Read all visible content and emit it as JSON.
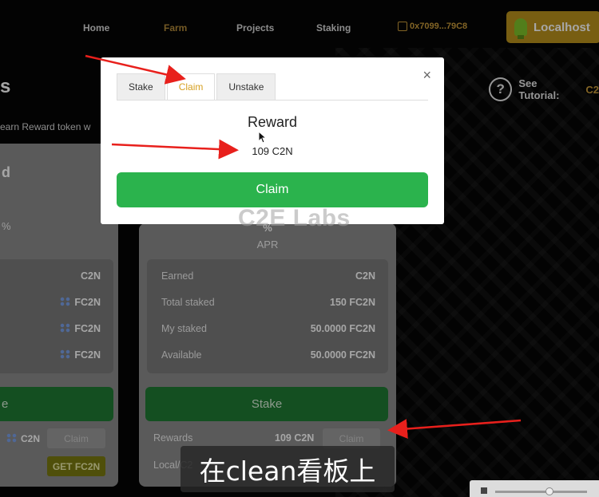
{
  "nav": {
    "links": [
      "Home",
      "Farm",
      "Projects",
      "Staking"
    ],
    "wallet_address": "0x7099...79C8",
    "network_button": "Localhost"
  },
  "page": {
    "title_fragment": "s",
    "subtitle_fragment": "earn Reward token w",
    "tutorial_label": "See Tutorial:",
    "tutorial_link": "C2"
  },
  "left_card": {
    "symbol_fragment": "d",
    "percent_fragment": "%",
    "rows": [
      {
        "value": "C2N"
      },
      {
        "value": "FC2N"
      },
      {
        "value": "FC2N"
      },
      {
        "value": "FC2N"
      }
    ],
    "button_fragment": "e",
    "reward_token": "C2N",
    "claim_label": "Claim",
    "get_label": "GET FC2N"
  },
  "mid_card": {
    "percent": "%",
    "apr_label": "APR",
    "rows": [
      {
        "label": "Earned",
        "value": "C2N"
      },
      {
        "label": "Total staked",
        "value": "150 FC2N"
      },
      {
        "label": "My staked",
        "value": "50.0000 FC2N"
      },
      {
        "label": "Available",
        "value": "50.0000 FC2N"
      }
    ],
    "stake_button": "Stake",
    "rewards_label": "Rewards",
    "rewards_value": "109 C2N",
    "claim_label": "Claim",
    "local_label": "Local/C2"
  },
  "modal": {
    "tabs": [
      "Stake",
      "Claim",
      "Unstake"
    ],
    "active_tab": "Claim",
    "close_symbol": "×",
    "reward_title": "Reward",
    "reward_amount": "109 C2N",
    "claim_button": "Claim"
  },
  "watermark": "C2E Labs",
  "caption": "在clean看板上",
  "colors": {
    "accent_gold": "#c89a3a",
    "claim_green": "#2bb34d",
    "arrow_red": "#e8201c"
  }
}
